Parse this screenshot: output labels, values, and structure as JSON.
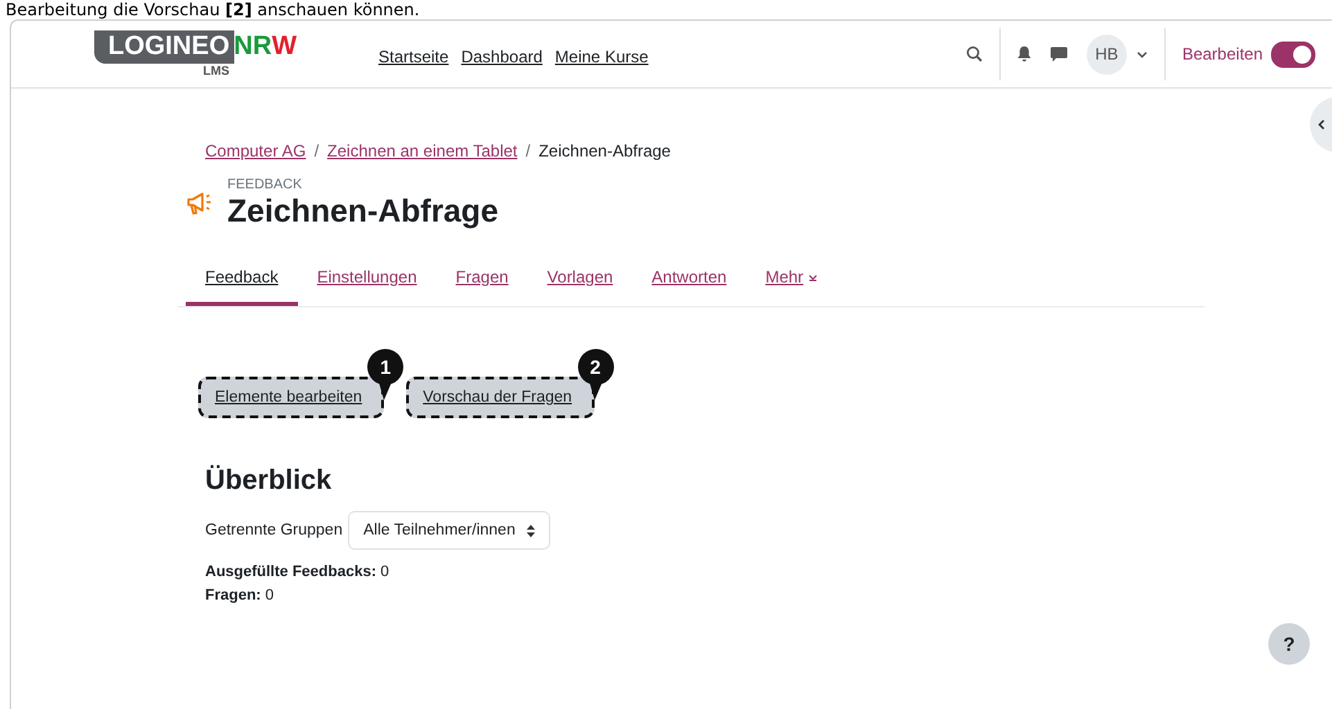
{
  "caption": "Bearbeitung die Vorschau **[2]** anschauen können.",
  "navbar": {
    "logo": {
      "main": "LOGINEO",
      "accent_1": "NR",
      "accent_2": "W",
      "sub": "LMS"
    },
    "links": [
      "Startseite",
      "Dashboard",
      "Meine Kurse"
    ],
    "avatar": "HB",
    "edit_mode": {
      "label": "Bearbeiten",
      "on": true
    }
  },
  "breadcrumb": [
    {
      "label": "Computer AG",
      "link": true
    },
    {
      "separator": "/",
      "label": "Zeichnen an einem Tablet",
      "link": true
    },
    {
      "separator": "/",
      "label": "Zeichnen-Abfrage",
      "link": false
    }
  ],
  "header": {
    "type": "FEEDBACK",
    "title": "Zeichnen-Abfrage"
  },
  "tabs": [
    {
      "label": "Feedback",
      "selected": true
    },
    {
      "label": "Einstellungen",
      "selected": false
    },
    {
      "label": "Fragen",
      "selected": false
    },
    {
      "label": "Vorlagen",
      "selected": false
    },
    {
      "label": "Antworten",
      "selected": false
    },
    {
      "label": "Mehr",
      "selected": false,
      "kind": "menu"
    }
  ],
  "actions": [
    {
      "label": "Elemente bearbeiten",
      "marker": "1"
    },
    {
      "label": "Vorschau der Fragen",
      "marker": "2"
    }
  ],
  "overview": {
    "title": "Überblick",
    "group_label": "Getrennte Gruppen",
    "group_value": "Alle Teilnehmer/innen",
    "stats": [
      {
        "label": "Ausgefüllte Feedbacks:",
        "value": "0"
      },
      {
        "label": "Fragen:",
        "value": "0"
      }
    ]
  },
  "help": "?"
}
